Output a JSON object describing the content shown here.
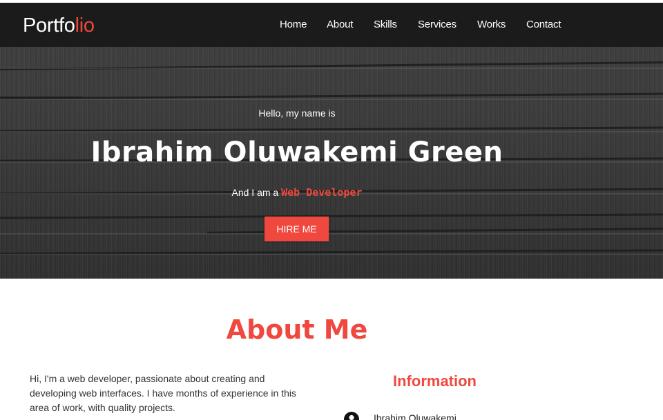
{
  "brand": {
    "logo_main": "Portfo",
    "logo_accent": "lio"
  },
  "nav": {
    "items": [
      {
        "label": "Home"
      },
      {
        "label": "About"
      },
      {
        "label": "Skills"
      },
      {
        "label": "Services"
      },
      {
        "label": "Works"
      },
      {
        "label": "Contact"
      }
    ]
  },
  "hero": {
    "greeting": "Hello, my name is",
    "name": "Ibrahim Oluwakemi Green",
    "tagline_prefix": "And I am a ",
    "tagline_role": "Web Developer",
    "cta_label": "HIRE ME"
  },
  "about": {
    "title": "About Me",
    "text": "Hi, I'm a web developer, passionate about creating and developing web interfaces. I have months of experience in this area of work, with quality projects.",
    "info_title": "Information",
    "info_rows": [
      {
        "icon": "user-icon",
        "value": "Ibrahim Oluwakemi"
      }
    ]
  },
  "colors": {
    "accent": "#f0483e",
    "navbar": "#1b1b1b",
    "hero_bg": "#383838"
  }
}
